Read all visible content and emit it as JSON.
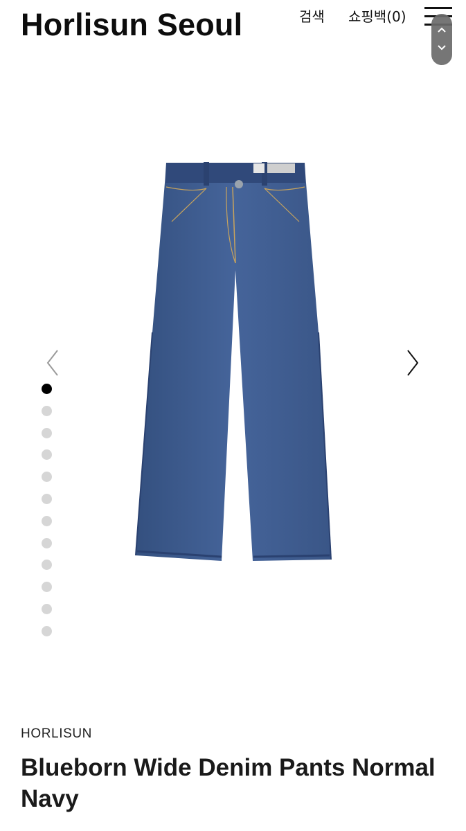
{
  "header": {
    "logo": "Horlisun Seoul",
    "search_label": "검색",
    "cart_label": "쇼핑백(0)"
  },
  "gallery": {
    "image_alt": "denim-pants-front-image",
    "total_images": 12,
    "active_index": 0,
    "dots": [
      {
        "active": true
      },
      {
        "active": false
      },
      {
        "active": false
      },
      {
        "active": false
      },
      {
        "active": false
      },
      {
        "active": false
      },
      {
        "active": false
      },
      {
        "active": false
      },
      {
        "active": false
      },
      {
        "active": false
      },
      {
        "active": false
      },
      {
        "active": false
      }
    ]
  },
  "product": {
    "brand": "HORLISUN",
    "name": "Blueborn Wide Denim Pants Normal Navy"
  },
  "colors": {
    "denim": "#3d5a8c",
    "denim_dark": "#2c4573",
    "stitch": "#c9a45c",
    "dot_active": "#000000",
    "dot_inactive": "#d6d6d6"
  }
}
